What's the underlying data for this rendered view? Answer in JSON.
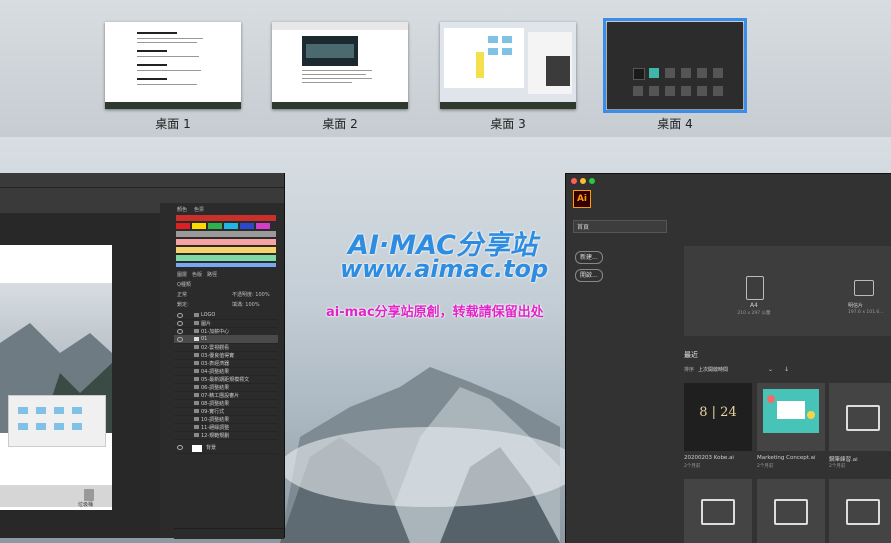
{
  "spaces": [
    {
      "label": "桌面 1"
    },
    {
      "label": "桌面 2"
    },
    {
      "label": "桌面 3"
    },
    {
      "label": "桌面 4"
    }
  ],
  "colors": {
    "active_space_outline": "#3a8ee8",
    "ai_accent": "#ff9a00",
    "watermark_blue": "#2e8de0",
    "watermark_pink": "#e024c8"
  },
  "watermark": {
    "line1": "AI·MAC分享站",
    "line2": "www.aimac.top",
    "line3": "ai-mac分享站原創，转载請保留出处"
  },
  "photoshop": {
    "panel_tabs": [
      "顏色",
      "色票"
    ],
    "layers_tabs": [
      "圖層",
      "色版",
      "路徑"
    ],
    "kind_label": "Q種類",
    "blend_label": "正常",
    "opacity_label": "不透明度: 100%",
    "lock_label": "鎖定:",
    "fill_label": "填滿: 100%",
    "layers": [
      "LOGO",
      "圖片",
      "01-加薪中心",
      "01",
      "02-雲視觀看",
      "03-優良值得實",
      "03-表經濟器",
      "04-調整結果",
      "05-最新期距規模標文",
      "06-調整結果",
      "07-精工團設審片",
      "08-調整結果",
      "09-實行式",
      "10-調整結果",
      "11-絕緣調整",
      "12-規範規劃",
      "背景"
    ],
    "dock_tooltip": "垃圾桶"
  },
  "illustrator": {
    "logo": "Ai",
    "search_label": "首頁",
    "new_button": "新建...",
    "open_button": "開啟...",
    "preset_a4": "A4",
    "preset_a4_size": "210 x 297 公釐",
    "preset_other": "明信片",
    "preset_other_size": "197.6 x 101.6...",
    "recent_title": "最近",
    "sort_label": "排序",
    "sort_value": "上次開啟時間",
    "files": [
      {
        "name": "20200203 Kobe.ai",
        "date": "2个月前",
        "thumb": "8 | 24"
      },
      {
        "name": "Marketing Concept.ai",
        "date": "2个月前"
      },
      {
        "name": "鋼筆練習.ai",
        "date": "2个月前"
      }
    ]
  }
}
